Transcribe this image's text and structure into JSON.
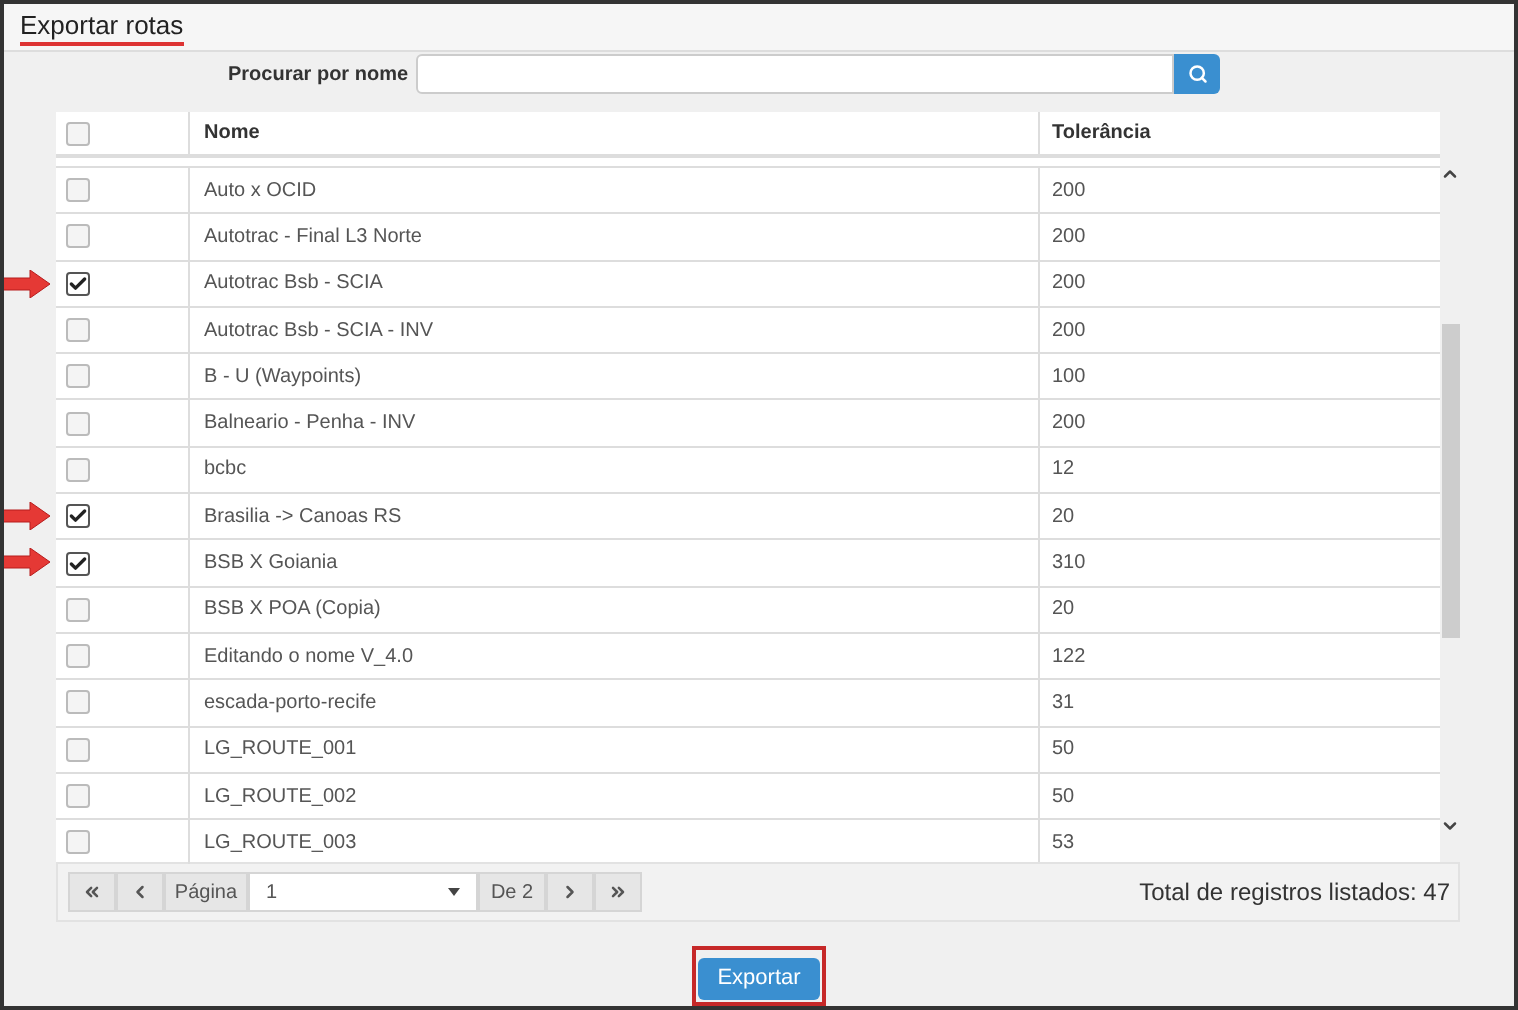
{
  "title": "Exportar rotas",
  "search": {
    "label": "Procurar por nome"
  },
  "table": {
    "columns": [
      "Nome",
      "Tolerância"
    ],
    "select_all": {
      "checked": false
    },
    "rows": [
      {
        "name": "Auto x OCID",
        "tolerance": "200",
        "checked": false
      },
      {
        "name": "Autotrac - Final L3 Norte",
        "tolerance": "200",
        "checked": false
      },
      {
        "name": "Autotrac Bsb - SCIA",
        "tolerance": "200",
        "checked": true
      },
      {
        "name": "Autotrac Bsb - SCIA - INV",
        "tolerance": "200",
        "checked": false
      },
      {
        "name": "B - U (Waypoints)",
        "tolerance": "100",
        "checked": false
      },
      {
        "name": "Balneario - Penha - INV",
        "tolerance": "200",
        "checked": false
      },
      {
        "name": "bcbc",
        "tolerance": "12",
        "checked": false
      },
      {
        "name": "Brasilia -> Canoas RS",
        "tolerance": "20",
        "checked": true
      },
      {
        "name": "BSB X Goiania",
        "tolerance": "310",
        "checked": true
      },
      {
        "name": "BSB X POA (Copia)",
        "tolerance": "20",
        "checked": false
      },
      {
        "name": "Editando o nome V_4.0",
        "tolerance": "122",
        "checked": false
      },
      {
        "name": "escada-porto-recife",
        "tolerance": "31",
        "checked": false
      },
      {
        "name": "LG_ROUTE_001",
        "tolerance": "50",
        "checked": false
      },
      {
        "name": "LG_ROUTE_002",
        "tolerance": "50",
        "checked": false
      },
      {
        "name": "LG_ROUTE_003",
        "tolerance": "53",
        "checked": false
      }
    ]
  },
  "pagination": {
    "page_label": "Página",
    "page": "1",
    "of": "De 2",
    "total": "Total de registros listados: 47"
  },
  "export_button": "Exportar"
}
